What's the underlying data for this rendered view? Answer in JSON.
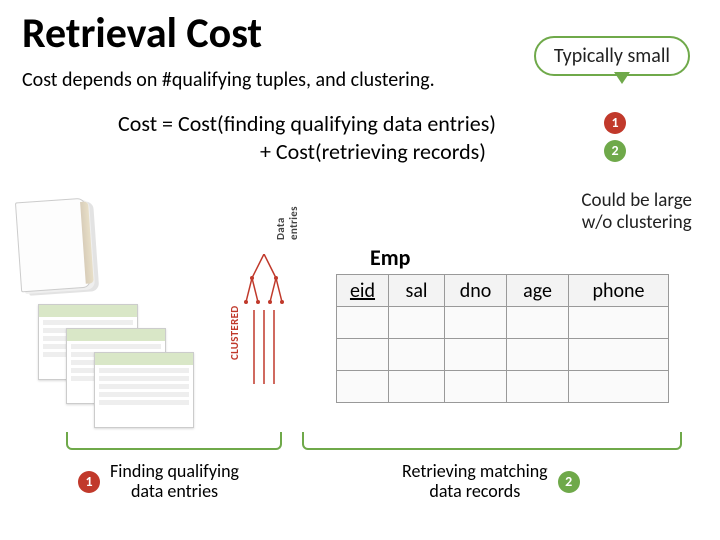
{
  "title": "Retrieval Cost",
  "subtitle": "Cost depends on #qualifying tuples, and clustering.",
  "callout_top": "Typically small",
  "equation": {
    "line1": "Cost =  Cost(finding qualifying data entries)",
    "line2": "+ Cost(retrieving records)"
  },
  "eq_badges": {
    "first": "1",
    "second": "2"
  },
  "callout_mid": {
    "l1": "Could be large",
    "l2": "w/o clustering"
  },
  "diagram_labels": {
    "data_entries": "Data entries",
    "clustered": "CLUSTERED"
  },
  "emp": {
    "label": "Emp",
    "columns": [
      "eid",
      "sal",
      "dno",
      "age",
      "phone"
    ],
    "rows": 3
  },
  "bottom": {
    "left_badge": "1",
    "left_text_l1": "Finding qualifying",
    "left_text_l2": "data entries",
    "right_text_l1": "Retrieving matching",
    "right_text_l2": "data records",
    "right_badge": "2"
  }
}
